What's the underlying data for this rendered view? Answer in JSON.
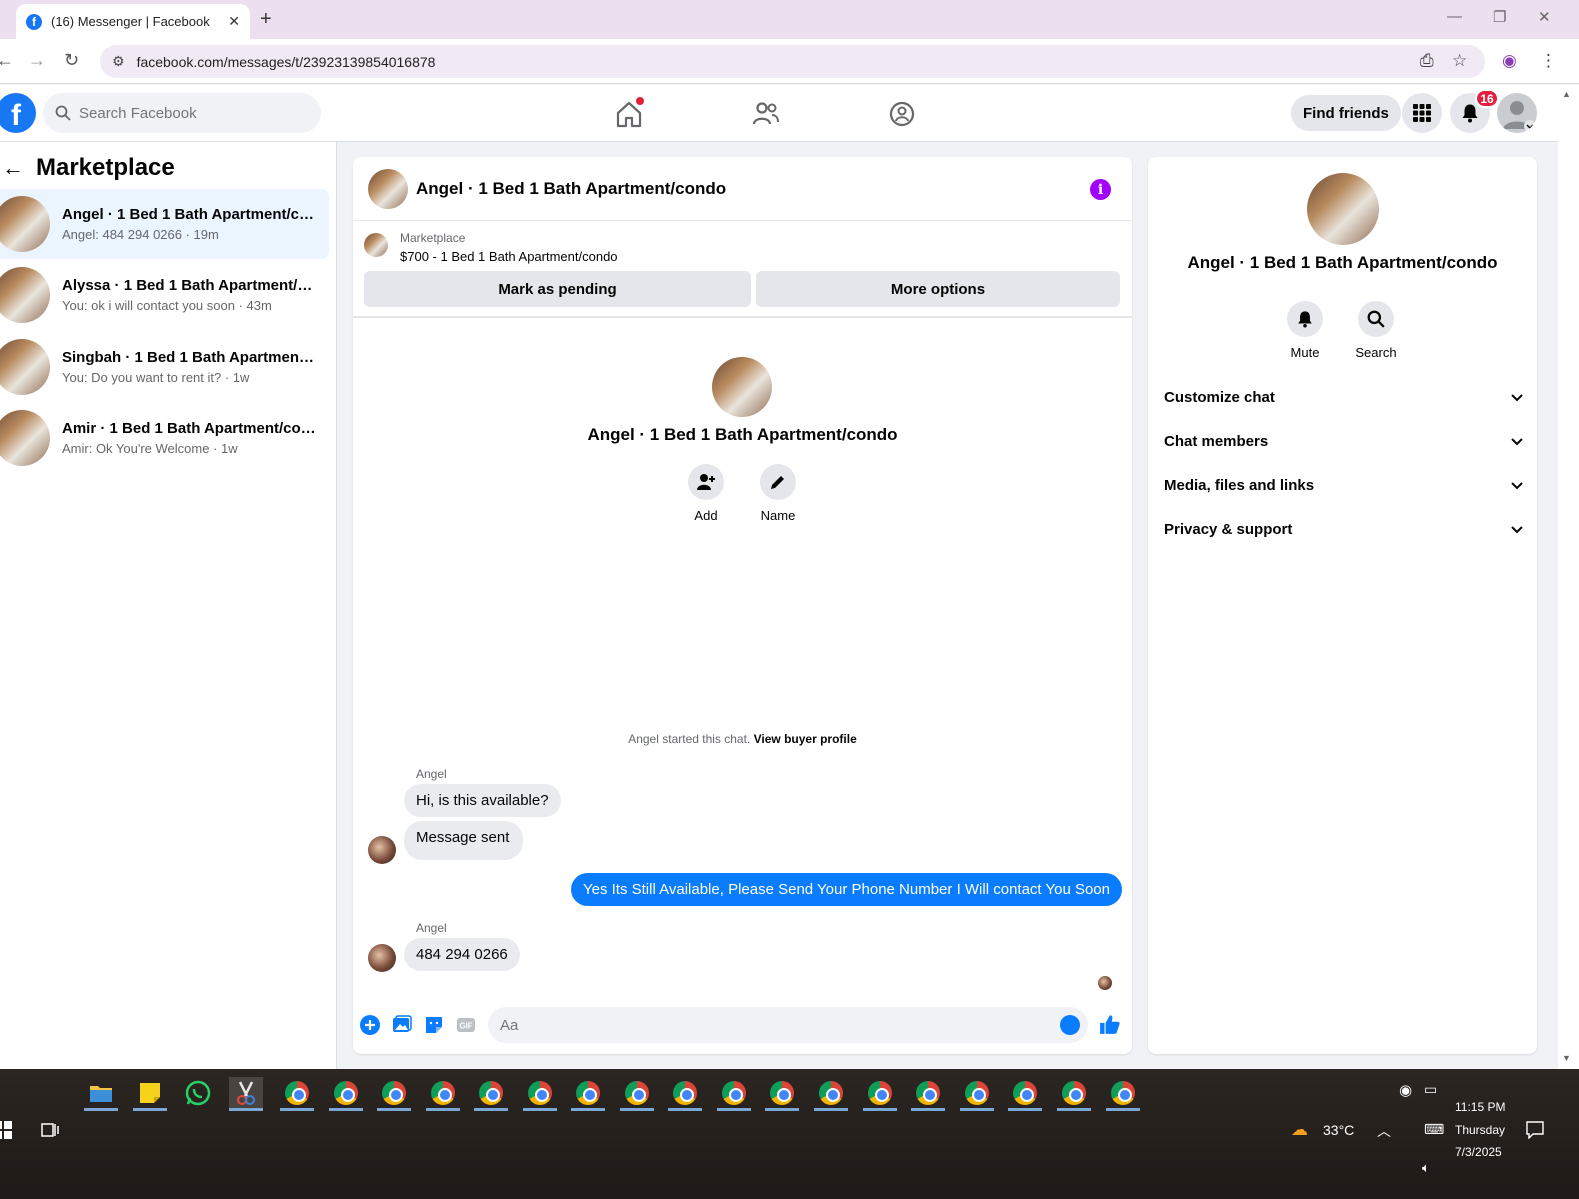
{
  "browser": {
    "tab_title": "(16) Messenger | Facebook",
    "url": "facebook.com/messages/t/23923139854016878"
  },
  "fb_header": {
    "search_placeholder": "Search Facebook",
    "find_friends": "Find friends",
    "notifications_count": "16"
  },
  "left_panel": {
    "title": "Marketplace",
    "conversations": [
      {
        "name": "Angel · 1 Bed 1 Bath Apartment/condo",
        "preview": "Angel: 484 294 0266 · 19m"
      },
      {
        "name": "Alyssa · 1 Bed 1 Bath Apartment/condo",
        "preview": "You: ok i will contact you soon · 43m"
      },
      {
        "name": "Singbah · 1 Bed 1 Bath Apartment/condo",
        "preview": "You: Do you want to rent it? · 1w"
      },
      {
        "name": "Amir · 1 Bed 1 Bath Apartment/condo",
        "preview": "Amir: Ok You're Welcome · 1w"
      }
    ]
  },
  "chat": {
    "title": "Angel · 1 Bed 1 Bath Apartment/condo",
    "marketplace_label": "Marketplace",
    "listing": "$700 - 1 Bed 1 Bath Apartment/condo",
    "mark_pending": "Mark as pending",
    "more_options": "More options",
    "intro_name": "Angel · 1 Bed 1 Bath Apartment/condo",
    "add_label": "Add",
    "name_label": "Name",
    "started_text": "Angel started this chat.",
    "view_profile": "View buyer profile",
    "messages": [
      {
        "sender": "Angel",
        "text": "Hi, is this available?"
      },
      {
        "text": "Message sent"
      },
      {
        "text": "Yes Its Still Available, Please Send Your Phone Number I Will contact You Soon"
      },
      {
        "sender": "Angel",
        "text": "484 294 0266"
      }
    ],
    "composer_placeholder": "Aa"
  },
  "right_panel": {
    "name": "Angel · 1 Bed 1 Bath Apartment/condo",
    "mute": "Mute",
    "search": "Search",
    "sections": [
      "Customize chat",
      "Chat members",
      "Media, files and links",
      "Privacy & support"
    ]
  },
  "taskbar": {
    "temperature": "33°C",
    "time": "11:15 PM",
    "day": "Thursday",
    "date": "7/3/2025"
  }
}
